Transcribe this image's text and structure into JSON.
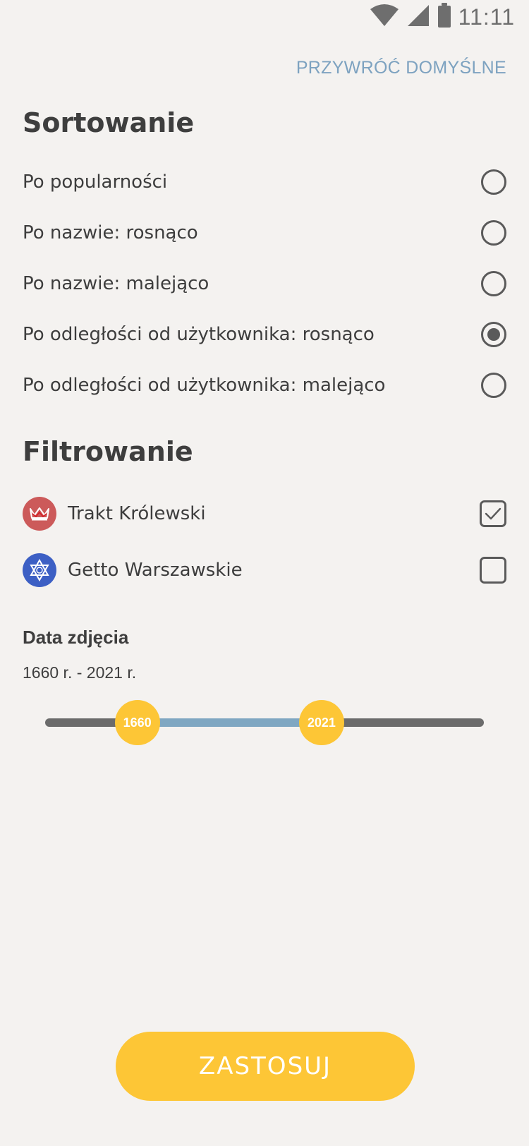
{
  "status_bar": {
    "time": "11:11",
    "icons": [
      "wifi-icon",
      "cellular-signal-icon",
      "battery-icon"
    ]
  },
  "header": {
    "reset_label": "PRZYWRÓĆ DOMYŚLNE"
  },
  "sorting": {
    "title": "Sortowanie",
    "options": [
      {
        "label": "Po popularności",
        "selected": false
      },
      {
        "label": "Po nazwie: rosnąco",
        "selected": false
      },
      {
        "label": "Po nazwie: malejąco",
        "selected": false
      },
      {
        "label": "Po odległości od użytkownika: rosnąco",
        "selected": true
      },
      {
        "label": "Po odległości od użytkownika: malejąco",
        "selected": false
      }
    ]
  },
  "filtering": {
    "title": "Filtrowanie",
    "routes": [
      {
        "label": "Trakt Królewski",
        "icon": "crown-icon",
        "color": "#cc5a5a",
        "checked": true
      },
      {
        "label": "Getto Warszawskie",
        "icon": "star-of-david-icon",
        "color": "#3c5fc4",
        "checked": false
      }
    ]
  },
  "photo_date": {
    "title": "Data zdjęcia",
    "range_text": "1660 r. - 2021 r.",
    "min_label": "1660",
    "max_label": "2021",
    "lower_fraction": 0.21,
    "upper_fraction": 0.63
  },
  "colors": {
    "accent": "#fdc636",
    "link": "#7da2c0",
    "slider_fill": "#7fa7c2",
    "background": "#f4f2f0"
  },
  "apply_label": "ZASTOSUJ"
}
